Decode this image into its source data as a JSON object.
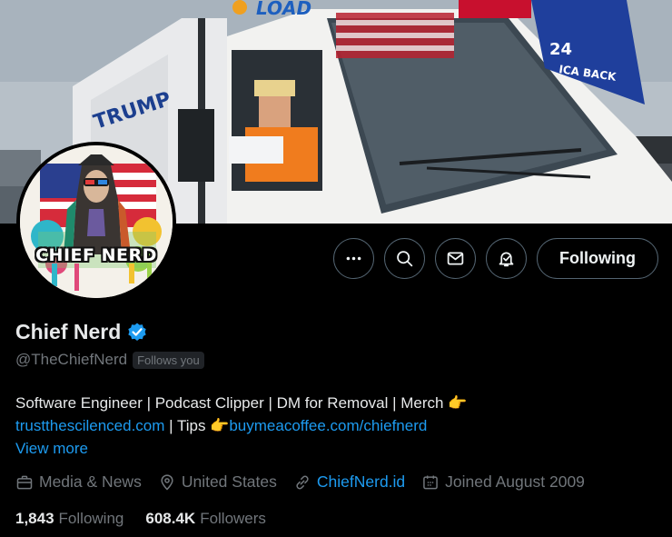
{
  "profile": {
    "avatar_text": "CHIEF NERD",
    "display_name": "Chief Nerd",
    "handle": "@TheChiefNerd",
    "follows_you": "Follows you",
    "bio": {
      "line1": "Software Engineer | Podcast Clipper |  DM for Removal | Merch",
      "line1_emoji": "👉",
      "line2_link1": "trustthescilenced.com",
      "line2_text": " | Tips ",
      "line2_emoji": "👉",
      "line2_link2": "buymeacoffee.com/chiefnerd"
    },
    "view_more": "View more",
    "meta": {
      "category": "Media & News",
      "location": "United States",
      "website": "ChiefNerd.id",
      "joined": "Joined August 2009"
    },
    "stats": {
      "following_count": "1,843",
      "following_label": "Following",
      "followers_count": "608.4K",
      "followers_label": "Followers"
    }
  },
  "actions": {
    "more_icon": "more-icon",
    "search_icon": "search-icon",
    "message_icon": "mail-icon",
    "notify_icon": "bell-subscribed-icon",
    "following_label": "Following"
  },
  "banner": {
    "truck_text_top": "LOAD",
    "truck_side_text": "TRUMP",
    "flag_text_1": "24",
    "flag_text_2": "ICA BACK"
  },
  "colors": {
    "background": "#000000",
    "text_primary": "#e7e9ea",
    "text_secondary": "#71767b",
    "link": "#1d9bf0",
    "border": "#536471",
    "verified": "#1d9bf0"
  }
}
